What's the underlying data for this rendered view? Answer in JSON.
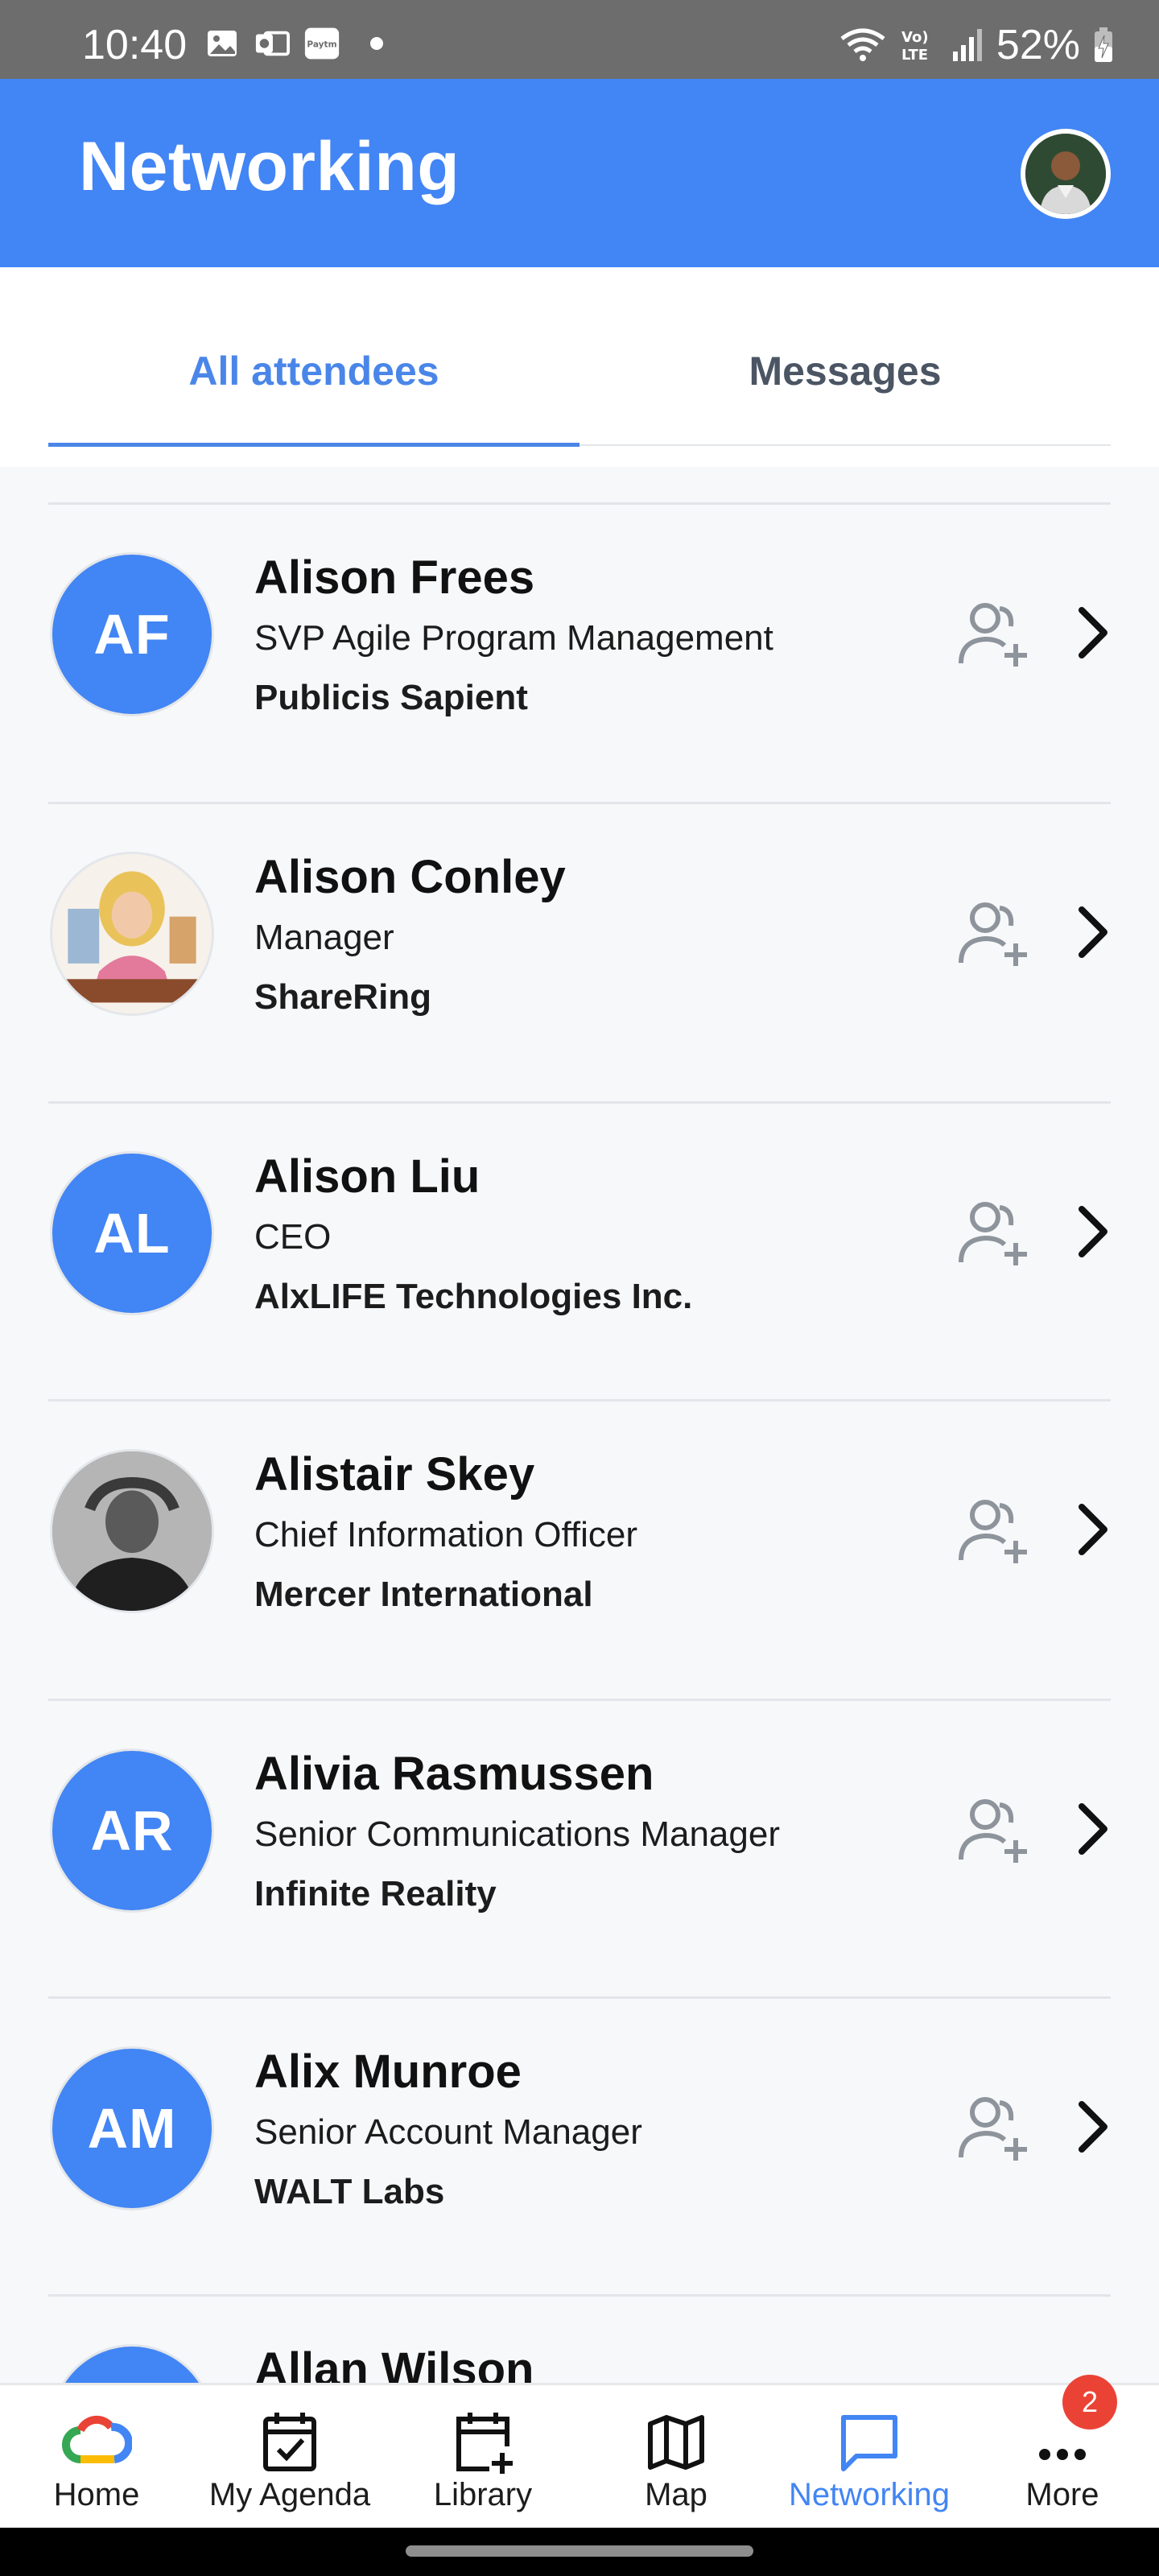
{
  "status_bar": {
    "time": "10:40",
    "paytm_label": "Paytm",
    "battery": "52%"
  },
  "app_bar": {
    "title": "Networking"
  },
  "tabs": [
    {
      "label": "All attendees",
      "active": true
    },
    {
      "label": "Messages",
      "active": false
    }
  ],
  "attendees": [
    {
      "name": "Alison Frees",
      "title": "SVP Agile Program Management",
      "company": "Publicis Sapient",
      "initials": "AF",
      "has_photo": false
    },
    {
      "name": "Alison Conley",
      "title": "Manager",
      "company": "ShareRing",
      "initials": "",
      "has_photo": true
    },
    {
      "name": "Alison Liu",
      "title": "CEO",
      "company": "AlxLIFE Technologies Inc.",
      "initials": "AL",
      "has_photo": false
    },
    {
      "name": "Alistair Skey",
      "title": "Chief Information Officer",
      "company": "Mercer International",
      "initials": "",
      "has_photo": true
    },
    {
      "name": "Alivia Rasmussen",
      "title": "Senior Communications Manager",
      "company": "Infinite Reality",
      "initials": "AR",
      "has_photo": false
    },
    {
      "name": "Alix Munroe",
      "title": "Senior Account Manager",
      "company": "WALT Labs",
      "initials": "AM",
      "has_photo": false
    },
    {
      "name": "Allan Wilson",
      "title": "",
      "company": "",
      "initials": "",
      "has_photo": false
    }
  ],
  "bottom_nav": [
    {
      "label": "Home",
      "icon": "google-cloud-icon",
      "active": false
    },
    {
      "label": "My Agenda",
      "icon": "calendar-check-icon",
      "active": false
    },
    {
      "label": "Library",
      "icon": "calendar-plus-icon",
      "active": false
    },
    {
      "label": "Map",
      "icon": "map-icon",
      "active": false
    },
    {
      "label": "Networking",
      "icon": "chat-icon",
      "active": true
    },
    {
      "label": "More",
      "icon": "more-dots-icon",
      "active": false
    }
  ],
  "more_badge": "2",
  "colors": {
    "primary": "#4285f4",
    "tab_active": "#4a86e8",
    "badge": "#ea4335"
  }
}
